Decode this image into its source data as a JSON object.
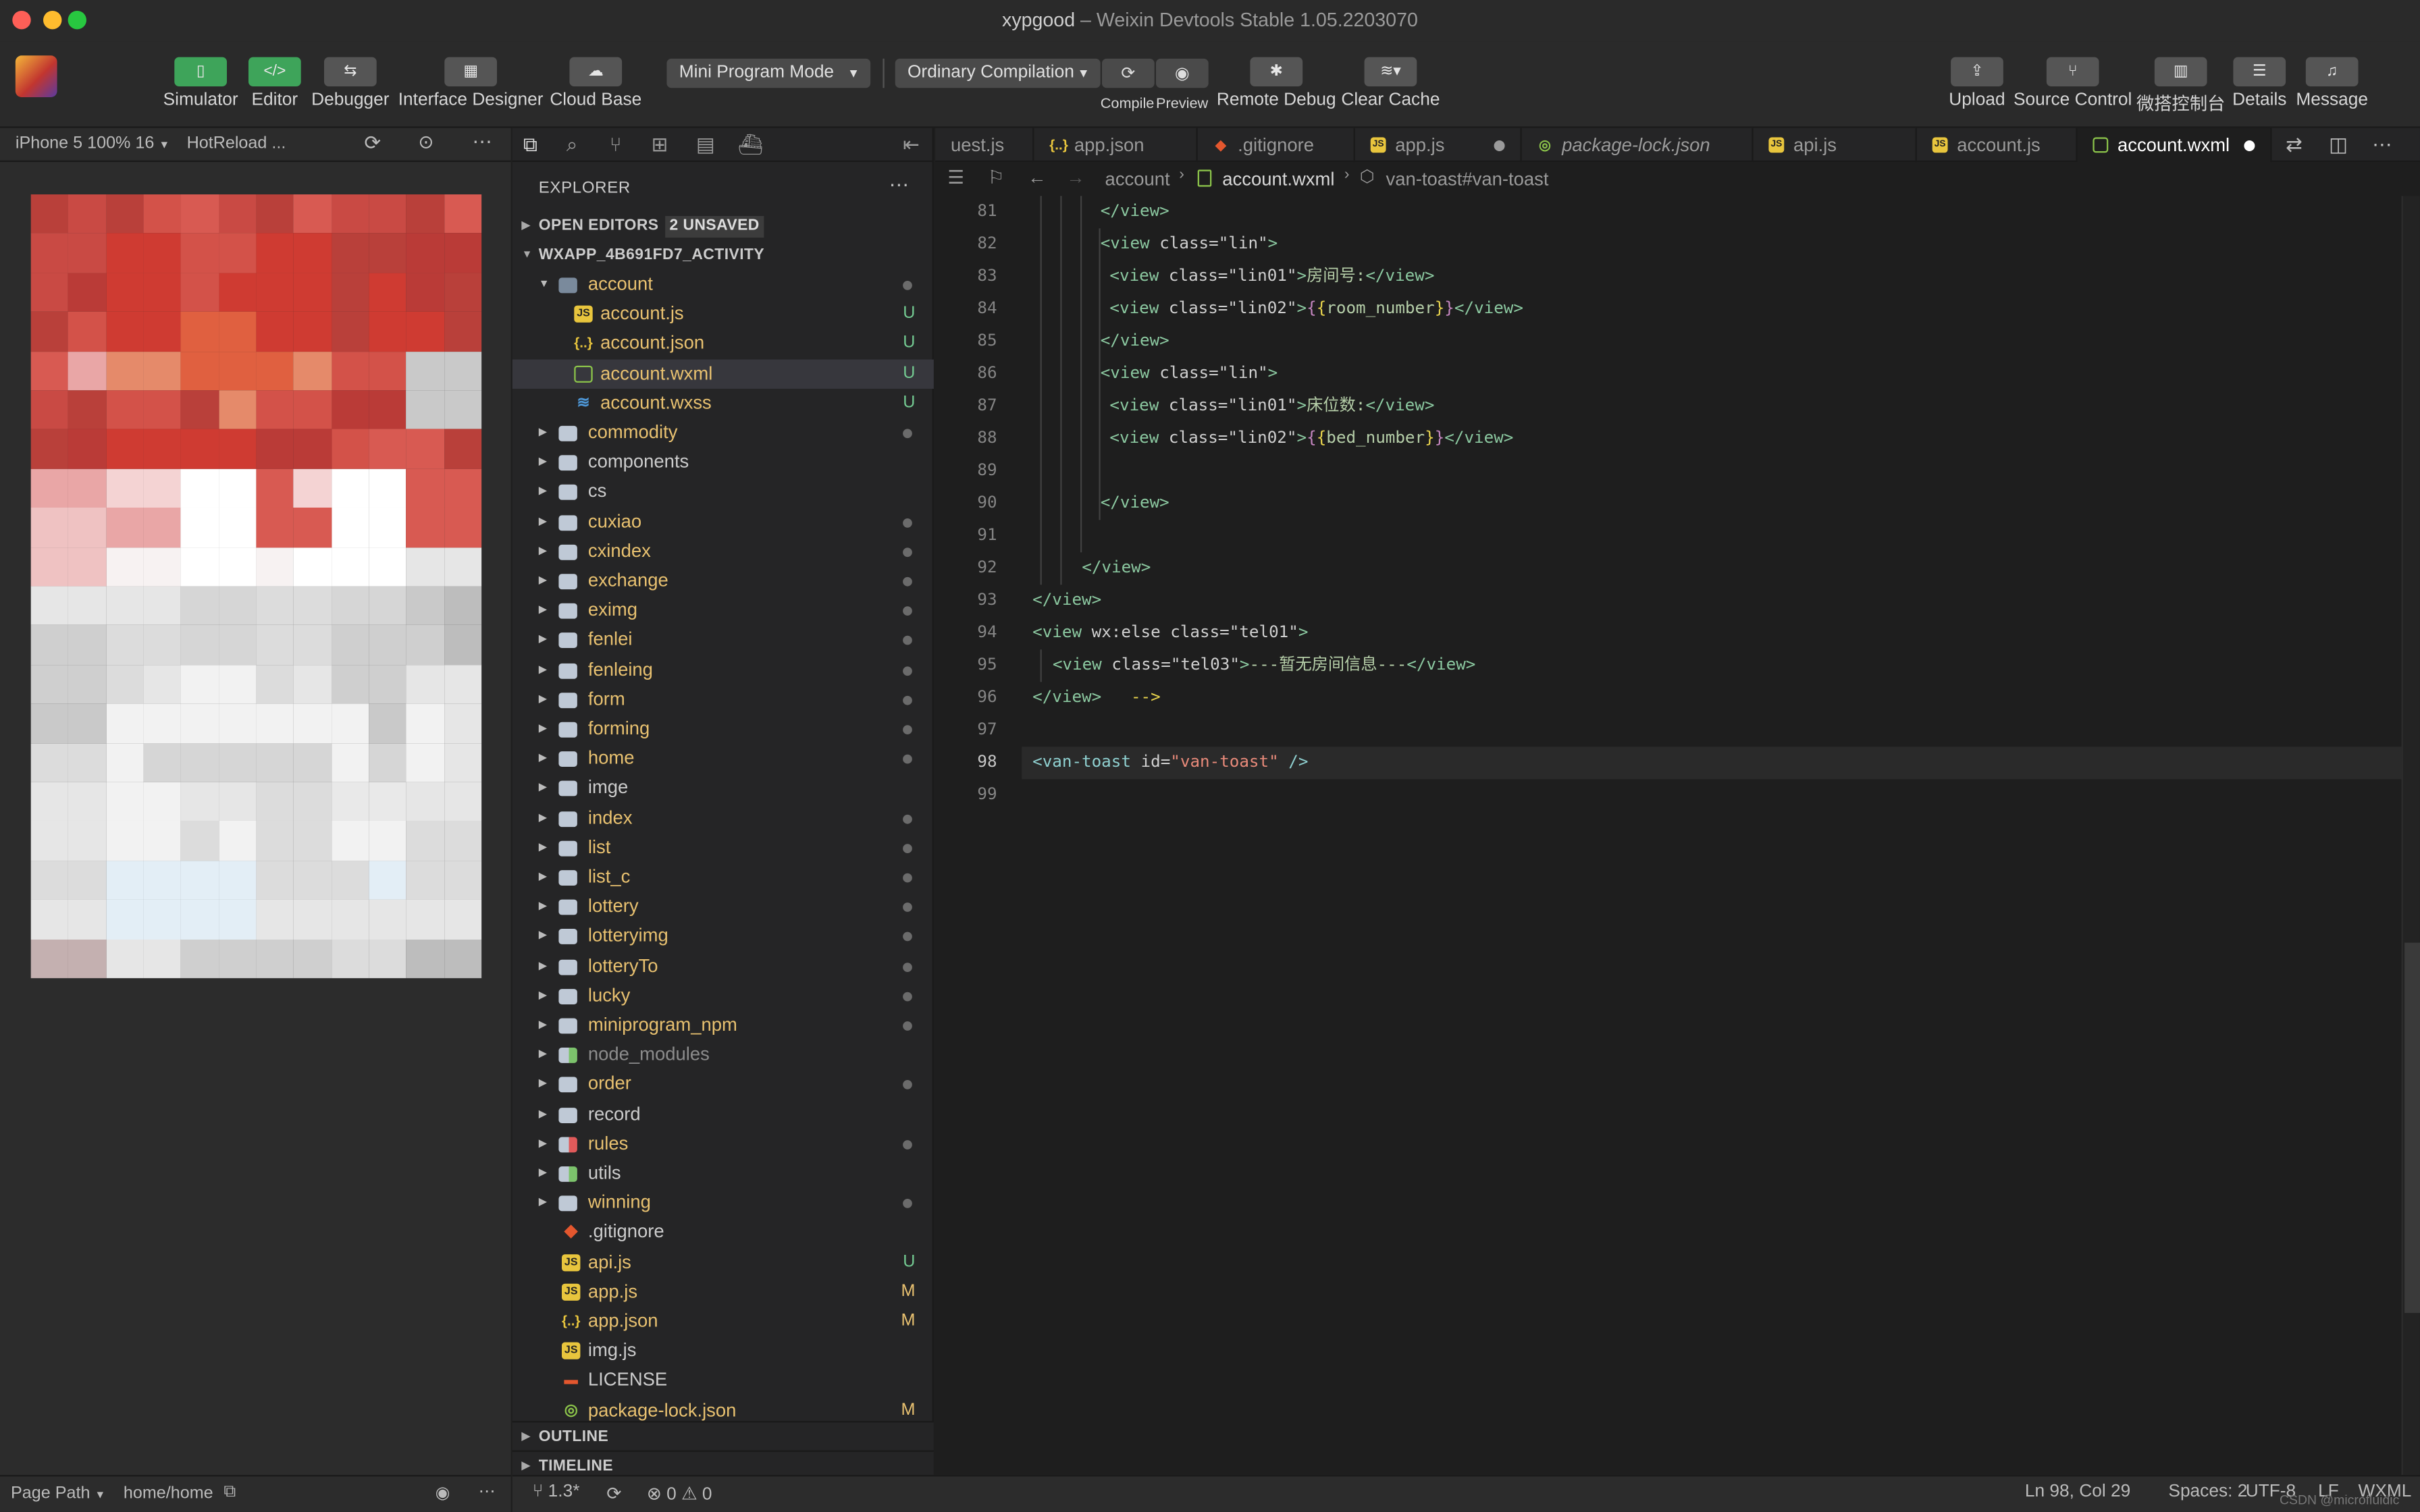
{
  "window": {
    "project": "xypgood",
    "separator": " – ",
    "app": "Weixin Devtools Stable 1.05.2203070"
  },
  "toolbar": {
    "simulator": "Simulator",
    "editor": "Editor",
    "debugger": "Debugger",
    "interface_designer": "Interface Designer",
    "cloud_base": "Cloud Base",
    "mode": "Mini Program Mode",
    "compilation": "Ordinary Compilation",
    "compile": "Compile",
    "preview": "Preview",
    "remote_debug": "Remote Debug",
    "clear_cache": "Clear Cache",
    "upload": "Upload",
    "source_control": "Source Control",
    "wechat_console": "微搭控制台",
    "details": "Details",
    "message": "Message"
  },
  "simulator": {
    "device": "iPhone 5 100% 16",
    "hotreload": "HotReload ...",
    "page_path_label": "Page Path",
    "page_path": "home/home"
  },
  "explorer": {
    "title": "EXPLORER",
    "open_editors": "OPEN EDITORS",
    "unsaved": "2 UNSAVED",
    "project": "WXAPP_4B691FD7_ACTIVITY",
    "outline": "OUTLINE",
    "timeline": "TIMELINE",
    "rows": [
      {
        "name": "account",
        "type": "folder-open",
        "depth": 1,
        "color": "#e8c170",
        "status": "dot"
      },
      {
        "name": "account.js",
        "type": "js",
        "depth": 2,
        "color": "#e8c170",
        "status": "U"
      },
      {
        "name": "account.json",
        "type": "json",
        "depth": 2,
        "color": "#e8c170",
        "status": "U"
      },
      {
        "name": "account.wxml",
        "type": "wxml",
        "depth": 2,
        "color": "#e8c170",
        "status": "U",
        "active": true
      },
      {
        "name": "account.wxss",
        "type": "wxss",
        "depth": 2,
        "color": "#e8c170",
        "status": "U"
      },
      {
        "name": "commodity",
        "type": "folder",
        "depth": 1,
        "color": "#e8c170",
        "status": "dot"
      },
      {
        "name": "components",
        "type": "folder",
        "depth": 1,
        "color": "#cccccc",
        "status": ""
      },
      {
        "name": "cs",
        "type": "folder",
        "depth": 1,
        "color": "#cccccc",
        "status": ""
      },
      {
        "name": "cuxiao",
        "type": "folder",
        "depth": 1,
        "color": "#e8c170",
        "status": "dot"
      },
      {
        "name": "cxindex",
        "type": "folder",
        "depth": 1,
        "color": "#e8c170",
        "status": "dot"
      },
      {
        "name": "exchange",
        "type": "folder",
        "depth": 1,
        "color": "#e8c170",
        "status": "dot"
      },
      {
        "name": "eximg",
        "type": "folder",
        "depth": 1,
        "color": "#e8c170",
        "status": "dot"
      },
      {
        "name": "fenlei",
        "type": "folder",
        "depth": 1,
        "color": "#e8c170",
        "status": "dot"
      },
      {
        "name": "fenleing",
        "type": "folder",
        "depth": 1,
        "color": "#e8c170",
        "status": "dot"
      },
      {
        "name": "form",
        "type": "folder",
        "depth": 1,
        "color": "#e8c170",
        "status": "dot"
      },
      {
        "name": "forming",
        "type": "folder",
        "depth": 1,
        "color": "#e8c170",
        "status": "dot"
      },
      {
        "name": "home",
        "type": "folder",
        "depth": 1,
        "color": "#e8c170",
        "status": "dot"
      },
      {
        "name": "imge",
        "type": "folder",
        "depth": 1,
        "color": "#cccccc",
        "status": ""
      },
      {
        "name": "index",
        "type": "folder",
        "depth": 1,
        "color": "#e8c170",
        "status": "dot"
      },
      {
        "name": "list",
        "type": "folder",
        "depth": 1,
        "color": "#e8c170",
        "status": "dot"
      },
      {
        "name": "list_c",
        "type": "folder",
        "depth": 1,
        "color": "#e8c170",
        "status": "dot"
      },
      {
        "name": "lottery",
        "type": "folder",
        "depth": 1,
        "color": "#e8c170",
        "status": "dot"
      },
      {
        "name": "lotteryimg",
        "type": "folder",
        "depth": 1,
        "color": "#e8c170",
        "status": "dot"
      },
      {
        "name": "lotteryTo",
        "type": "folder",
        "depth": 1,
        "color": "#e8c170",
        "status": "dot"
      },
      {
        "name": "lucky",
        "type": "folder",
        "depth": 1,
        "color": "#e8c170",
        "status": "dot"
      },
      {
        "name": "miniprogram_npm",
        "type": "folder",
        "depth": 1,
        "color": "#e8c170",
        "status": "dot"
      },
      {
        "name": "node_modules",
        "type": "folder-green",
        "depth": 1,
        "color": "#8c8c8c",
        "status": ""
      },
      {
        "name": "order",
        "type": "folder",
        "depth": 1,
        "color": "#e8c170",
        "status": "dot"
      },
      {
        "name": "record",
        "type": "folder",
        "depth": 1,
        "color": "#cccccc",
        "status": ""
      },
      {
        "name": "rules",
        "type": "folder-red",
        "depth": 1,
        "color": "#e8c170",
        "status": "dot"
      },
      {
        "name": "utils",
        "type": "folder-green",
        "depth": 1,
        "color": "#cccccc",
        "status": ""
      },
      {
        "name": "winning",
        "type": "folder",
        "depth": 1,
        "color": "#e8c170",
        "status": "dot"
      },
      {
        "name": ".gitignore",
        "type": "git",
        "depth": 1,
        "color": "#cccccc",
        "status": ""
      },
      {
        "name": "api.js",
        "type": "js",
        "depth": 1,
        "color": "#e8c170",
        "status": "U"
      },
      {
        "name": "app.js",
        "type": "js",
        "depth": 1,
        "color": "#e8c170",
        "status": "M"
      },
      {
        "name": "app.json",
        "type": "json",
        "depth": 1,
        "color": "#e8c170",
        "status": "M"
      },
      {
        "name": "img.js",
        "type": "js",
        "depth": 1,
        "color": "#cccccc",
        "status": ""
      },
      {
        "name": "LICENSE",
        "type": "lic",
        "depth": 1,
        "color": "#cccccc",
        "status": ""
      },
      {
        "name": "package-lock.json",
        "type": "pkg",
        "depth": 1,
        "color": "#e8c170",
        "status": "M"
      }
    ]
  },
  "tabs": [
    {
      "name": "uest.js",
      "type": "none",
      "italic": false,
      "dirty": false
    },
    {
      "name": "app.json",
      "type": "json",
      "italic": false,
      "dirty": false
    },
    {
      "name": ".gitignore",
      "type": "git",
      "italic": false,
      "dirty": false
    },
    {
      "name": "app.js",
      "type": "js",
      "italic": false,
      "dirty": true
    },
    {
      "name": "package-lock.json",
      "type": "pkg",
      "italic": true,
      "dirty": false
    },
    {
      "name": "api.js",
      "type": "js",
      "italic": false,
      "dirty": false
    },
    {
      "name": "account.js",
      "type": "js",
      "italic": false,
      "dirty": false
    },
    {
      "name": "account.wxml",
      "type": "wxml",
      "italic": false,
      "dirty": true,
      "active": true
    }
  ],
  "breadcrumb": {
    "folder": "account",
    "file": "account.wxml",
    "symbol": "van-toast#van-toast"
  },
  "editor": {
    "lines": [
      {
        "n": "81",
        "html": "<span class='tg'>&lt;/view&gt;</span>",
        "indent": 44
      },
      {
        "n": "82",
        "html": "<span class='tg'>&lt;view</span> <span class='at'>class</span>=<span class='sv'>\"lin\"</span><span class='tg'>&gt;</span>",
        "indent": 44
      },
      {
        "n": "83",
        "html": "<span class='tg'>&lt;view</span> <span class='at'>class</span>=<span class='sv'>\"lin01\"</span><span class='tg'>&gt;</span><span class='bv'>房间号:</span><span class='tg'>&lt;/view&gt;</span>",
        "indent": 50
      },
      {
        "n": "84",
        "html": "<span class='tg'>&lt;view</span> <span class='at'>class</span>=<span class='sv'>\"lin02\"</span><span class='tg'>&gt;</span><span class='br'>{</span><span class='cn'>{</span><span class='bv'>room_number</span><span class='cn'>}</span><span class='br'>}</span><span class='tg'>&lt;/view&gt;</span>",
        "indent": 50
      },
      {
        "n": "85",
        "html": "<span class='tg'>&lt;/view&gt;</span>",
        "indent": 44
      },
      {
        "n": "86",
        "html": "<span class='tg'>&lt;view</span> <span class='at'>class</span>=<span class='sv'>\"lin\"</span><span class='tg'>&gt;</span>",
        "indent": 44
      },
      {
        "n": "87",
        "html": "<span class='tg'>&lt;view</span> <span class='at'>class</span>=<span class='sv'>\"lin01\"</span><span class='tg'>&gt;</span><span class='bv'>床位数:</span><span class='tg'>&lt;/view&gt;</span>",
        "indent": 50
      },
      {
        "n": "88",
        "html": "<span class='tg'>&lt;view</span> <span class='at'>class</span>=<span class='sv'>\"lin02\"</span><span class='tg'>&gt;</span><span class='br'>{</span><span class='cn'>{</span><span class='bv'>bed_number</span><span class='cn'>}</span><span class='br'>}</span><span class='tg'>&lt;/view&gt;</span>",
        "indent": 50
      },
      {
        "n": "89",
        "html": "",
        "indent": 44
      },
      {
        "n": "90",
        "html": "<span class='tg'>&lt;/view&gt;</span>",
        "indent": 44
      },
      {
        "n": "91",
        "html": "",
        "indent": 32
      },
      {
        "n": "92",
        "html": "<span class='tg'>&lt;/view&gt;</span>",
        "indent": 32
      },
      {
        "n": "93",
        "html": "<span class='tg'>&lt;/view&gt;</span>",
        "indent": 0
      },
      {
        "n": "94",
        "html": "<span class='tg'>&lt;view</span> <span class='at'>wx:else class</span>=<span class='sv'>\"tel01\"</span><span class='tg'>&gt;</span>",
        "indent": 0
      },
      {
        "n": "95",
        "html": "<span class='tg'>&lt;view</span> <span class='at'>class</span>=<span class='sv'>\"tel03\"</span><span class='tg'>&gt;</span><span class='bv'>---暂无房间信息---</span><span class='tg'>&lt;/view&gt;</span>",
        "indent": 13
      },
      {
        "n": "96",
        "html": "<span class='tg'>&lt;/view&gt;</span>   <span class='cn'>--&gt;</span>",
        "indent": 0
      },
      {
        "n": "97",
        "html": "",
        "indent": 0
      },
      {
        "n": "98",
        "html": "<span class='tgb'>&lt;van-toast</span> <span class='at'>id</span>=<span class='sv2'>\"van-toast\"</span> <span class='tgb'>/&gt;</span>",
        "indent": 0,
        "current": true
      },
      {
        "n": "99",
        "html": "",
        "indent": 0
      }
    ]
  },
  "status": {
    "branch": "1.3*",
    "errors": "0",
    "warnings": "0",
    "position": "Ln 98, Col 29",
    "spaces": "Spaces: 2",
    "encoding": "UTF-8",
    "eol": "LF",
    "language": "WXML",
    "watermark": "CSDN @microfluidic"
  },
  "colors": {
    "accent_green": "#3ea45a",
    "modified": "#e8c170",
    "untracked": "#73c991"
  }
}
